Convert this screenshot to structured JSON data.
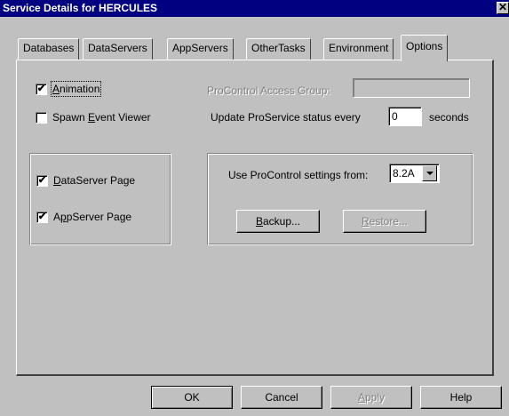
{
  "window": {
    "title": "Service Details for HERCULES",
    "close_glyph": "✕"
  },
  "tabs": [
    {
      "label": "Databases"
    },
    {
      "label": "DataServers"
    },
    {
      "label": "AppServers"
    },
    {
      "label": "OtherTasks"
    },
    {
      "label": "Environment"
    },
    {
      "label": "Options",
      "active": true
    }
  ],
  "options": {
    "animation": {
      "label_pre": "",
      "mnemonic": "A",
      "label_post": "nimation",
      "checked": true
    },
    "spawn_event_viewer": {
      "label_pre": "Spawn ",
      "mnemonic": "E",
      "label_post": "vent Viewer",
      "checked": false
    },
    "procontrol_access_group": {
      "label": "ProControl Access Group:",
      "value": "",
      "enabled": false
    },
    "update_status": {
      "label": "Update ProService status every",
      "value": "0",
      "suffix": "seconds"
    },
    "dataserver_page": {
      "label_pre": "",
      "mnemonic": "D",
      "label_post": "ataServer Page",
      "checked": true
    },
    "appserver_page": {
      "label_pre": "A",
      "mnemonic": "p",
      "label_post": "pServer Page",
      "checked": true
    },
    "procontrol_settings": {
      "label": "Use ProControl settings from:",
      "selected": "8.2A"
    },
    "backup_button": {
      "mnemonic": "B",
      "label_post": "ackup..."
    },
    "restore_button": {
      "mnemonic": "R",
      "label_post": "estore...",
      "enabled": false
    }
  },
  "footer": {
    "ok": "OK",
    "cancel": "Cancel",
    "apply": {
      "mnemonic": "A",
      "label_post": "pply",
      "enabled": false
    },
    "help": "Help"
  },
  "icons": {
    "check": "✔",
    "dropdown": "chevron-down-icon"
  }
}
